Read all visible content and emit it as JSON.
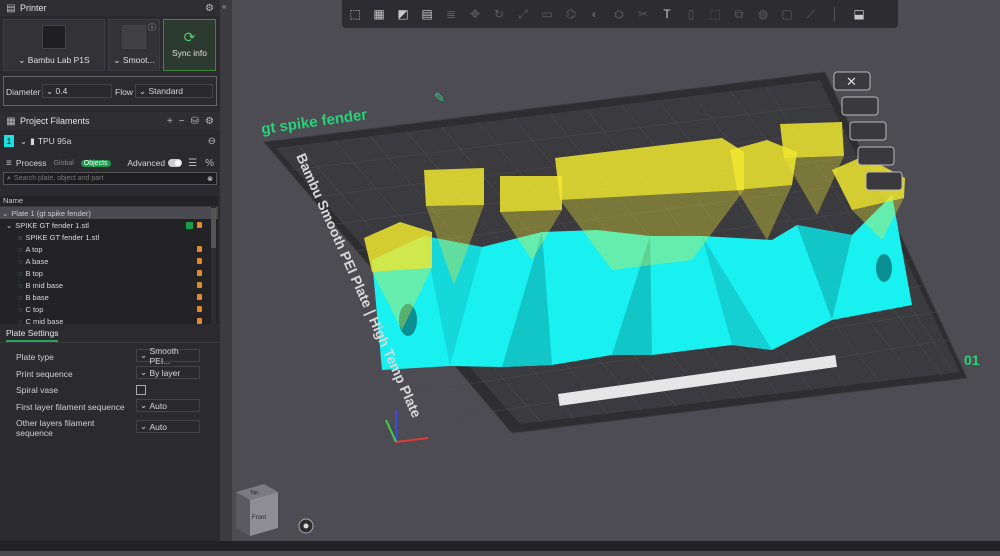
{
  "printer": {
    "title": "Printer",
    "model": "Bambu Lab P1S",
    "plate": "Smoot...",
    "sync_label": "Sync info",
    "diameter_label": "Diameter",
    "diameter_value": "0.4",
    "flow_label": "Flow",
    "flow_value": "Standard"
  },
  "filaments": {
    "title": "Project Filaments",
    "items": [
      {
        "index": "1",
        "name": "TPU 95a",
        "color": "#1fe0e0"
      }
    ]
  },
  "process": {
    "title": "Process",
    "global_label": "Global",
    "objects_label": "Objects",
    "advanced_label": "Advanced",
    "search_placeholder": "Search plate, object and part",
    "tree_header": "Name",
    "rows": [
      {
        "label": "Plate 1 (gt spike fender)"
      },
      {
        "label": "SPIKE GT fender 1.stl"
      },
      {
        "label": "SPIKE GT fender 1.stl"
      },
      {
        "label": "A top"
      },
      {
        "label": "A base"
      },
      {
        "label": "B top"
      },
      {
        "label": "B mid base"
      },
      {
        "label": "B base"
      },
      {
        "label": "C top"
      },
      {
        "label": "C mid base"
      }
    ]
  },
  "plate_settings": {
    "tab": "Plate Settings",
    "plate_type_label": "Plate type",
    "plate_type_value": "Smooth PEI...",
    "print_sequence_label": "Print sequence",
    "print_sequence_value": "By layer",
    "spiral_vase_label": "Spiral vase",
    "first_layer_label": "First layer filament sequence",
    "first_layer_value": "Auto",
    "other_layers_label_1": "Other layers filament",
    "other_layers_label_2": "sequence",
    "other_layers_value": "Auto"
  },
  "viewport": {
    "plate_name": "gt spike fender",
    "plate_side_text": "Bambu Smooth PEI Plate | High Temp Plate",
    "plate_number": "01",
    "cube_top": "Top",
    "cube_front": "Front",
    "model_color": "#19f0f0",
    "support_color": "#f0e830"
  }
}
